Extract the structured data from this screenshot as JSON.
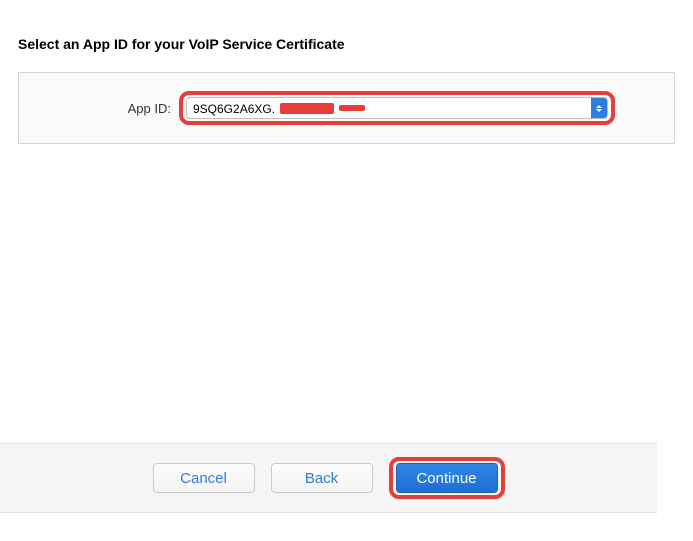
{
  "heading": "Select an App ID for your VoIP Service Certificate",
  "form": {
    "appIdLabel": "App ID:",
    "appIdValue": "9SQ6G2A6XG."
  },
  "footer": {
    "cancel": "Cancel",
    "back": "Back",
    "continue": "Continue"
  }
}
